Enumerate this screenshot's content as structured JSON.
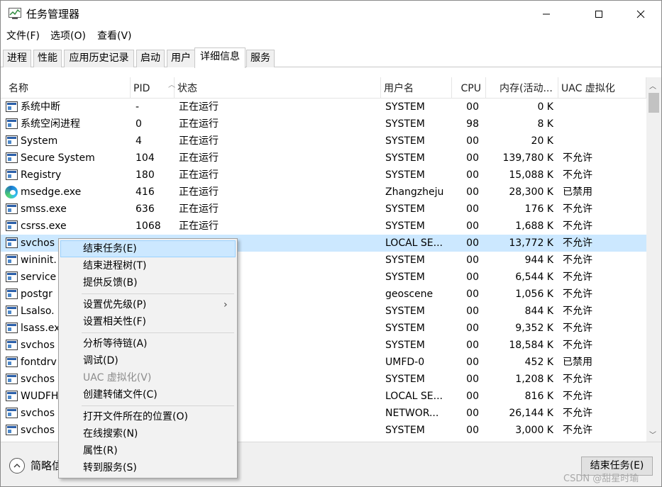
{
  "window": {
    "title": "任务管理器"
  },
  "menubar": {
    "items": [
      "文件(F)",
      "选项(O)",
      "查看(V)"
    ]
  },
  "tabs": [
    "进程",
    "性能",
    "应用历史记录",
    "启动",
    "用户",
    "详细信息",
    "服务"
  ],
  "active_tab": "详细信息",
  "columns": [
    "名称",
    "PID",
    "状态",
    "用户名",
    "CPU",
    "内存(活动...",
    "UAC 虚拟化"
  ],
  "rows": [
    {
      "name": "系统中断",
      "pid": "-",
      "status": "正在运行",
      "user": "SYSTEM",
      "cpu": "00",
      "mem": "0 K",
      "uac": "",
      "icon": "process-window-icon"
    },
    {
      "name": "系统空闲进程",
      "pid": "0",
      "status": "正在运行",
      "user": "SYSTEM",
      "cpu": "98",
      "mem": "8 K",
      "uac": "",
      "icon": "process-window-icon"
    },
    {
      "name": "System",
      "pid": "4",
      "status": "正在运行",
      "user": "SYSTEM",
      "cpu": "00",
      "mem": "20 K",
      "uac": "",
      "icon": "process-window-icon"
    },
    {
      "name": "Secure System",
      "pid": "104",
      "status": "正在运行",
      "user": "SYSTEM",
      "cpu": "00",
      "mem": "139,780 K",
      "uac": "不允许",
      "icon": "process-window-icon"
    },
    {
      "name": "Registry",
      "pid": "180",
      "status": "正在运行",
      "user": "SYSTEM",
      "cpu": "00",
      "mem": "15,088 K",
      "uac": "不允许",
      "icon": "process-window-icon"
    },
    {
      "name": "msedge.exe",
      "pid": "416",
      "status": "正在运行",
      "user": "Zhangzheju",
      "cpu": "00",
      "mem": "28,300 K",
      "uac": "已禁用",
      "icon": "edge-browser-icon"
    },
    {
      "name": "smss.exe",
      "pid": "636",
      "status": "正在运行",
      "user": "SYSTEM",
      "cpu": "00",
      "mem": "176 K",
      "uac": "不允许",
      "icon": "process-window-icon"
    },
    {
      "name": "csrss.exe",
      "pid": "1068",
      "status": "正在运行",
      "user": "SYSTEM",
      "cpu": "00",
      "mem": "1,688 K",
      "uac": "不允许",
      "icon": "process-window-icon"
    },
    {
      "name": "svchos",
      "pid": "",
      "status": "",
      "user": "LOCAL SE...",
      "cpu": "00",
      "mem": "13,772 K",
      "uac": "不允许",
      "icon": "process-window-icon",
      "selected": true
    },
    {
      "name": "wininit.",
      "pid": "",
      "status": "",
      "user": "SYSTEM",
      "cpu": "00",
      "mem": "944 K",
      "uac": "不允许",
      "icon": "process-window-icon"
    },
    {
      "name": "service",
      "pid": "",
      "status": "",
      "user": "SYSTEM",
      "cpu": "00",
      "mem": "6,544 K",
      "uac": "不允许",
      "icon": "process-window-icon"
    },
    {
      "name": "postgr",
      "pid": "",
      "status": "",
      "user": "geoscene",
      "cpu": "00",
      "mem": "1,056 K",
      "uac": "不允许",
      "icon": "process-window-icon"
    },
    {
      "name": "Lsalso.",
      "pid": "",
      "status": "",
      "user": "SYSTEM",
      "cpu": "00",
      "mem": "844 K",
      "uac": "不允许",
      "icon": "process-window-icon"
    },
    {
      "name": "lsass.ex",
      "pid": "",
      "status": "",
      "user": "SYSTEM",
      "cpu": "00",
      "mem": "9,352 K",
      "uac": "不允许",
      "icon": "process-window-icon"
    },
    {
      "name": "svchos",
      "pid": "",
      "status": "",
      "user": "SYSTEM",
      "cpu": "00",
      "mem": "18,584 K",
      "uac": "不允许",
      "icon": "process-window-icon"
    },
    {
      "name": "fontdrv",
      "pid": "",
      "status": "",
      "user": "UMFD-0",
      "cpu": "00",
      "mem": "452 K",
      "uac": "已禁用",
      "icon": "process-window-icon"
    },
    {
      "name": "svchos",
      "pid": "",
      "status": "",
      "user": "SYSTEM",
      "cpu": "00",
      "mem": "1,208 K",
      "uac": "不允许",
      "icon": "process-window-icon"
    },
    {
      "name": "WUDFH",
      "pid": "",
      "status": "",
      "user": "LOCAL SE...",
      "cpu": "00",
      "mem": "816 K",
      "uac": "不允许",
      "icon": "process-window-icon"
    },
    {
      "name": "svchos",
      "pid": "",
      "status": "",
      "user": "NETWOR...",
      "cpu": "00",
      "mem": "26,144 K",
      "uac": "不允许",
      "icon": "process-window-icon"
    },
    {
      "name": "svchos",
      "pid": "",
      "status": "",
      "user": "SYSTEM",
      "cpu": "00",
      "mem": "3,000 K",
      "uac": "不允许",
      "icon": "process-window-icon"
    }
  ],
  "context_menu": {
    "items": [
      {
        "label": "结束任务(E)",
        "hover": true
      },
      {
        "label": "结束进程树(T)"
      },
      {
        "label": "提供反馈(B)"
      },
      {
        "separator": true
      },
      {
        "label": "设置优先级(P)",
        "submenu": true
      },
      {
        "label": "设置相关性(F)"
      },
      {
        "separator": true
      },
      {
        "label": "分析等待链(A)"
      },
      {
        "label": "调试(D)"
      },
      {
        "label": "UAC 虚拟化(V)",
        "disabled": true
      },
      {
        "label": "创建转储文件(C)"
      },
      {
        "separator": true
      },
      {
        "label": "打开文件所在的位置(O)"
      },
      {
        "label": "在线搜索(N)"
      },
      {
        "label": "属性(R)"
      },
      {
        "label": "转到服务(S)"
      }
    ]
  },
  "footer": {
    "less_details_label": "简略信",
    "end_task_label": "结束任务(E)",
    "watermark": "CSDN @甜星时瑜"
  },
  "colors": {
    "selection": "#cce8ff",
    "hover_border": "#99d1ff"
  }
}
